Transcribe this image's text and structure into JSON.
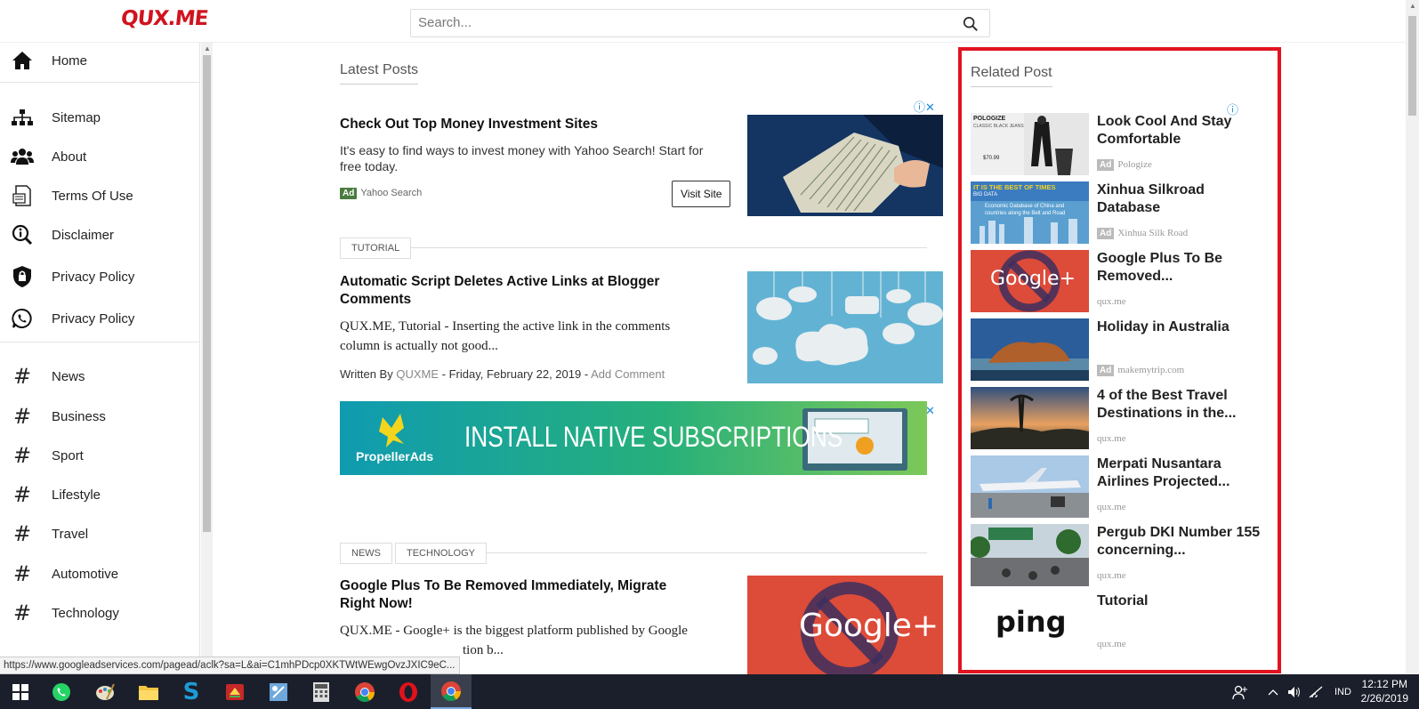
{
  "header": {
    "logo": "QUX.ME",
    "search_placeholder": "Search..."
  },
  "sidebar": {
    "items": [
      {
        "label": "Home",
        "icon": "home-icon"
      },
      {
        "label": "Sitemap",
        "icon": "sitemap-icon"
      },
      {
        "label": "About",
        "icon": "users-icon"
      },
      {
        "label": "Terms Of Use",
        "icon": "document-icon"
      },
      {
        "label": "Disclaimer",
        "icon": "info-search-icon"
      },
      {
        "label": "Privacy Policy",
        "icon": "shield-lock-icon"
      },
      {
        "label": "Privacy Policy",
        "icon": "whatsapp-icon"
      }
    ],
    "categories": [
      "News",
      "Business",
      "Sport",
      "Lifestyle",
      "Travel",
      "Automotive",
      "Technology"
    ]
  },
  "main": {
    "section_title": "Latest Posts",
    "ad1": {
      "title": "Check Out Top Money Investment Sites",
      "desc": "It's easy to find ways to invest money with Yahoo Search! Start for free today.",
      "badge": "Ad",
      "source": "Yahoo Search",
      "button": "Visit Site"
    },
    "post1": {
      "tag": "TUTORIAL",
      "title": "Automatic Script Deletes Active Links at Blogger Comments",
      "desc": "QUX.ME, Tutorial - Inserting the active link in the comments column is actually not good...",
      "written_by": "Written By",
      "author": "QUXME",
      "sep1": "-",
      "date": "Friday, February 22, 2019",
      "sep2": "-",
      "comment": "Add Comment"
    },
    "banner": {
      "brand": "PropellerAds",
      "text": "INSTALL NATIVE SUBSCRIPTIONS"
    },
    "post2": {
      "tags": [
        "NEWS",
        "TECHNOLOGY"
      ],
      "title": "Google Plus To Be Removed Immediately, Migrate Right Now!",
      "desc_line1": "QUX.ME - Google+ is the biggest platform published by Google",
      "desc_line2": "tion b..."
    }
  },
  "related": {
    "title": "Related Post",
    "items": [
      {
        "title": "Look Cool And Stay Comfortable",
        "source": "Pologize",
        "ad": true
      },
      {
        "title": "Xinhua Silkroad Database",
        "source": "Xinhua Silk Road",
        "ad": true
      },
      {
        "title": "Google Plus To Be Removed...",
        "source": "qux.me",
        "ad": false
      },
      {
        "title": "Holiday in Australia",
        "source": "makemytrip.com",
        "ad": true
      },
      {
        "title": "4 of the Best Travel Destinations in the...",
        "source": "qux.me",
        "ad": false
      },
      {
        "title": "Merpati Nusantara Airlines Projected...",
        "source": "qux.me",
        "ad": false
      },
      {
        "title": "Pergub DKI Number 155 concerning...",
        "source": "qux.me",
        "ad": false
      },
      {
        "title": "Tutorial",
        "source": "qux.me",
        "ad": false
      }
    ],
    "thumb_texts": {
      "pologize": "POLOGIZE",
      "pologize_sub": "CLASSIC BLACK JEANS",
      "price": "$70.99",
      "xinhua_banner": "IT IS THE BEST OF TIMES",
      "xinhua_sub": "BIG DATA",
      "xinhua_desc": "Economic Database of China and countries along the Belt and Road",
      "google_plus": "Google+",
      "ping": "ping"
    }
  },
  "status_url": "https://www.googleadservices.com/pagead/aclk?sa=L&ai=C1mhPDcp0XKTWtWEwgOvzJXIC9eC...",
  "taskbar": {
    "lang": "IND",
    "time": "12:12 PM",
    "date": "2/26/2019"
  },
  "colors": {
    "brand_red": "#d0141f",
    "highlight_box": "#e0131f",
    "taskbar": "#1b1f2b",
    "ad_green": "#4a7c3f",
    "link_gray": "#888888"
  }
}
